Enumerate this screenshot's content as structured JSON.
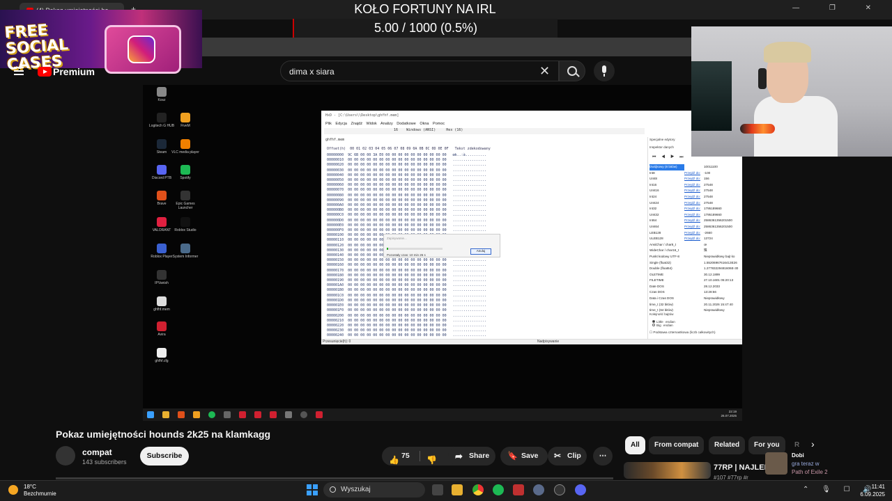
{
  "browser": {
    "tab_title": "(4) Pokaz umiejętności ho",
    "new_tab": "+",
    "window_controls": "— ❐ ✕"
  },
  "stream_overlay": {
    "wheel_title": "KOŁO FORTUNY NA IRL",
    "wheel_progress_text": "5.00 / 1000 (0.5%)",
    "wheel_progress_fraction": 0.005,
    "promo_text": "FREE SOCIAL CASES"
  },
  "youtube": {
    "brand": "Premium",
    "search": {
      "value": "dima x siara",
      "clear_icon": "close-icon",
      "search_icon": "search-icon",
      "mic_icon": "mic-icon"
    },
    "video": {
      "title": "Pokaz umiejętności hounds 2k25 na klamkagg",
      "channel": "compat",
      "subscribers": "143 subscribers",
      "subscribe_label": "Subscribe",
      "likes": "75",
      "share_label": "Share",
      "save_label": "Save",
      "clip_label": "Clip",
      "more_label": "⋯"
    },
    "chips": [
      "All",
      "From compat",
      "Related",
      "For you",
      "R"
    ],
    "related": {
      "title": "77RP | NAJLEF",
      "subtitle": "#107 #77rp #r"
    },
    "notification": {
      "name": "Dobi",
      "status": "gra teraz w",
      "game": "Path of Exile 2"
    }
  },
  "desktop": {
    "icons": [
      "Kosz",
      "Logitech G HUB",
      "FiveM",
      "Steam",
      "VLC media player",
      "Discord PTB",
      "Spotify",
      "Brave",
      "Epic Games Launcher",
      "VALORANT",
      "Roblox Studio",
      "Roblox Player",
      "System Informer",
      "IPVanish",
      "ghfhf.mem",
      "Avira",
      "ghfhf.cfg"
    ],
    "clock_time": "22:19",
    "clock_date": "26.07.2025"
  },
  "hex_editor": {
    "title": "HxD - [C:\\Users\\\\Desktop\\ghfhf.mem]",
    "menu": [
      "Plik",
      "Edycja",
      "Znajdź",
      "Widok",
      "Analizy",
      "Dodatkowe",
      "Okna",
      "Pomoc"
    ],
    "toolbar": {
      "cols": "16",
      "charset": "Windows (ANSI)",
      "mode": "Hex (16)"
    },
    "file_tab": "ghfhf.mem",
    "header": "Offset(h)  00 01 02 03 04 05 06 07 08 09 0A 0B 0C 0D 0E 0F   Tekst zdekodowany",
    "offsets": [
      "00000000",
      "00000010",
      "00000020",
      "00000030",
      "00000040",
      "00000050",
      "00000060",
      "00000070",
      "00000080",
      "00000090",
      "000000A0",
      "000000B0",
      "000000C0",
      "000000D0",
      "000000E0",
      "000000F0",
      "00000100",
      "00000110",
      "00000120",
      "00000130",
      "00000140",
      "00000150",
      "00000160",
      "00000170",
      "00000180",
      "00000190",
      "000001A0",
      "000001B0",
      "000001C0",
      "000001D0",
      "000001E0",
      "000001F0",
      "00000200",
      "00000210",
      "00000220",
      "00000230",
      "00000240"
    ],
    "first_row_bytes": "9C 6B 00 00 3A E0 00 00 00 00 00 00 00 00 00 00",
    "first_row_text": "œk..:à..........",
    "row_bytes": "00 00 00 00 00 00 00 00 00 00 00 00 00 00 00 00",
    "row_text": "................",
    "dialog": {
      "caption": "Zapisywanie...",
      "remaining": "Pozostały czas: 10 min 26 s",
      "cancel": "Anuluj",
      "progress_fraction": 0.03
    },
    "status_left": "Przesunięcie(h): 0",
    "status_mode": "Nadpisywanie",
    "panel_tabs": "Specjalne edytory",
    "inspector_title": "Inspektor danych",
    "inspector_nav": "⏮ ◀ ▶ ⏭",
    "inspector_rows": [
      {
        "k": "Dwójkowy (8 bitów)",
        "l": "",
        "v": "10011100"
      },
      {
        "k": "Int8",
        "l": "Przejdź do:",
        "v": "-100"
      },
      {
        "k": "UInt8",
        "l": "Przejdź do:",
        "v": "156"
      },
      {
        "k": "Int16",
        "l": "Przejdź do:",
        "v": "27548"
      },
      {
        "k": "UInt16",
        "l": "Przejdź do:",
        "v": "27548"
      },
      {
        "k": "Int24",
        "l": "Przejdź do:",
        "v": "27548"
      },
      {
        "k": "UInt24",
        "l": "Przejdź do:",
        "v": "27548"
      },
      {
        "k": "Int32",
        "l": "Przejdź do:",
        "v": "1795189660"
      },
      {
        "k": "UInt32",
        "l": "Przejdź do:",
        "v": "1795189660"
      },
      {
        "k": "Int64",
        "l": "Przejdź do:",
        "v": "2586361356201500"
      },
      {
        "k": "UInt64",
        "l": "Przejdź do:",
        "v": "2586361356201500"
      },
      {
        "k": "LEB128",
        "l": "Przejdź do:",
        "v": "-2660"
      },
      {
        "k": "ULEB128",
        "l": "Przejdź do:",
        "v": "13724"
      },
      {
        "k": "AnsiChar / char8_t",
        "l": "",
        "v": "œ"
      },
      {
        "k": "WideChar / char16_t",
        "l": "",
        "v": "殜"
      },
      {
        "k": "Punkt kodowy UTF-8",
        "l": "",
        "v": "Nieprawidłowy bajt ko"
      },
      {
        "k": "Single (float32)",
        "l": "",
        "v": "1.55206967616413E26"
      },
      {
        "k": "Double (float64)",
        "l": "",
        "v": "1.27783229481606E-30"
      },
      {
        "k": "OLETIME",
        "l": "",
        "v": "30.12.1899"
      },
      {
        "k": "FILETIME",
        "l": "",
        "v": "27.10.1601 05:20:13"
      },
      {
        "k": "Date DOS",
        "l": "",
        "v": "28.12.2033"
      },
      {
        "k": "Czas DOS",
        "l": "",
        "v": "13:28:56"
      },
      {
        "k": "Data i Czas DOS",
        "l": "",
        "v": "Nieprawidłowy"
      },
      {
        "k": "time_t (32 bitów)",
        "l": "",
        "v": "20.11.2026 15:47:40"
      },
      {
        "k": "time_t (64 bitów)",
        "l": "",
        "v": "Nieprawidłowy"
      }
    ],
    "byte_order_label": "Kolejność bajtów",
    "little_endian": "Little endian",
    "big_endian": "Big endian",
    "base_check": "Podstawa czternastkowa (liczb całkowitych)"
  },
  "taskbar": {
    "weather_temp": "18°C",
    "weather_desc": "Bezchmurnie",
    "search_placeholder": "Wyszukaj",
    "tray_icons": "⌃ 🎙 ☐ 🔊",
    "time": "11:41",
    "date": "6.09.2025"
  }
}
